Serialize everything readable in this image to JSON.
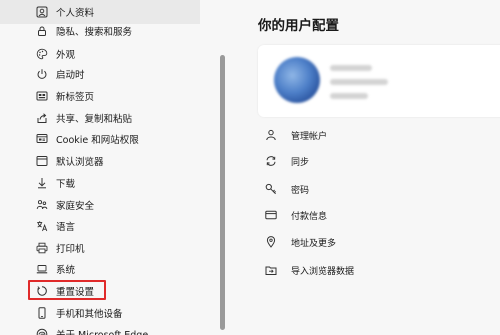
{
  "sidebar": {
    "items": [
      {
        "label": "个人资料",
        "icon": "profile-icon"
      },
      {
        "label": "隐私、搜索和服务",
        "icon": "lock-icon"
      },
      {
        "label": "外观",
        "icon": "palette-icon"
      },
      {
        "label": "启动时",
        "icon": "power-icon"
      },
      {
        "label": "新标签页",
        "icon": "new-tab-icon"
      },
      {
        "label": "共享、复制和粘贴",
        "icon": "share-icon"
      },
      {
        "label": "Cookie 和网站权限",
        "icon": "cookie-site-icon"
      },
      {
        "label": "默认浏览器",
        "icon": "browser-icon"
      },
      {
        "label": "下载",
        "icon": "download-icon"
      },
      {
        "label": "家庭安全",
        "icon": "family-icon"
      },
      {
        "label": "语言",
        "icon": "language-icon"
      },
      {
        "label": "打印机",
        "icon": "printer-icon"
      },
      {
        "label": "系统",
        "icon": "laptop-icon"
      },
      {
        "label": "重置设置",
        "icon": "reset-icon"
      },
      {
        "label": "手机和其他设备",
        "icon": "phone-icon"
      },
      {
        "label": "关于 Microsoft Edge",
        "icon": "edge-icon"
      }
    ],
    "selected_index": 0,
    "highlighted_index": 13
  },
  "main": {
    "title": "你的用户配置",
    "actions": [
      {
        "label": "管理帐户",
        "icon": "person-icon"
      },
      {
        "label": "同步",
        "icon": "sync-icon"
      },
      {
        "label": "密码",
        "icon": "key-icon"
      },
      {
        "label": "付款信息",
        "icon": "card-icon"
      },
      {
        "label": "地址及更多",
        "icon": "location-icon"
      },
      {
        "label": "导入浏览器数据",
        "icon": "import-icon"
      }
    ]
  },
  "colors": {
    "highlight": "#e02a2a",
    "sidebar_bg": "#f7f7f7",
    "card_bg": "#ffffff"
  }
}
